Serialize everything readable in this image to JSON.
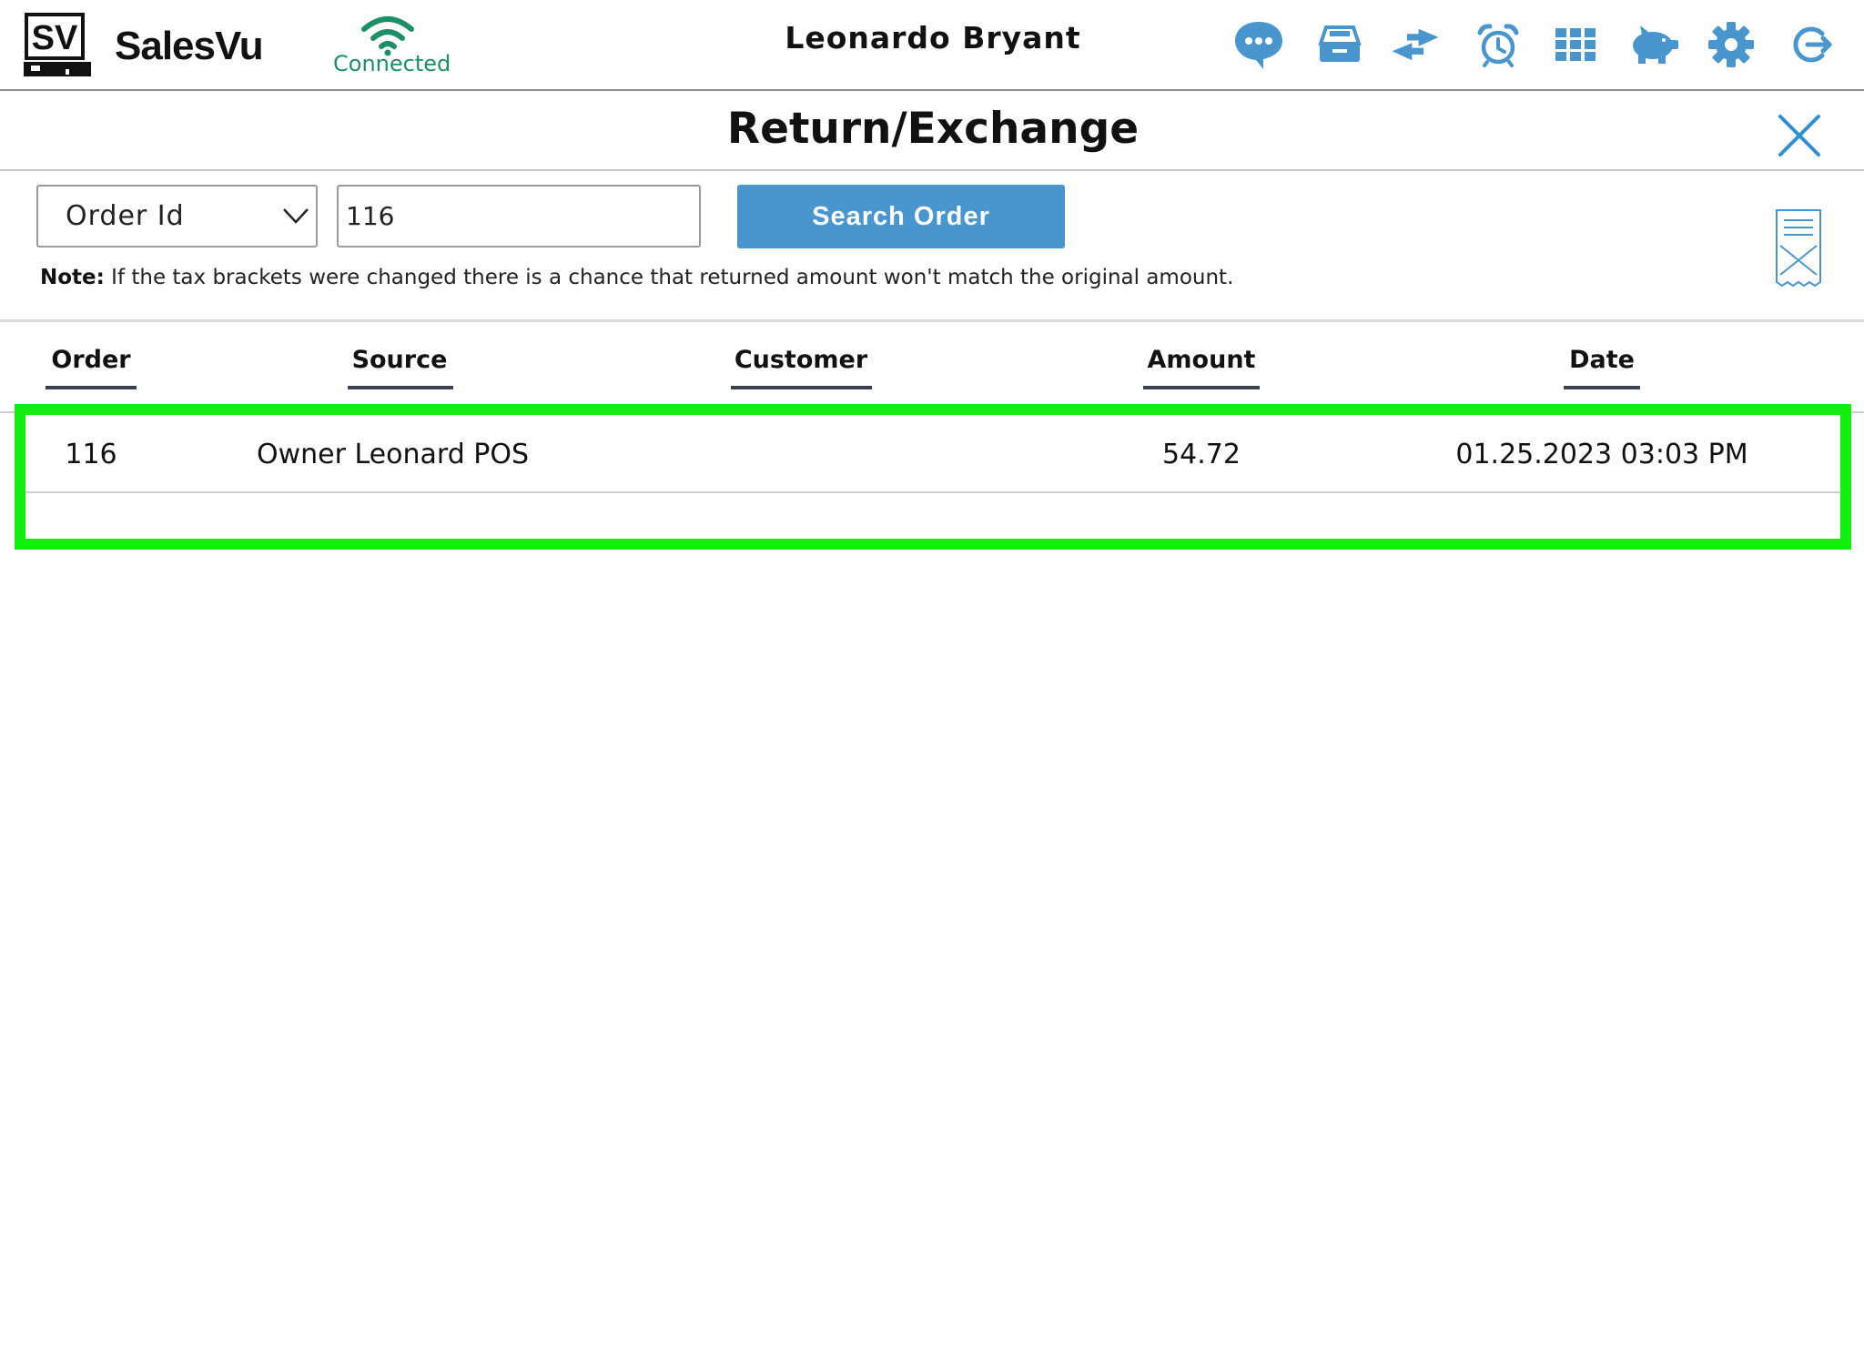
{
  "header": {
    "brand": "SalesVu",
    "logo_text": "SV",
    "status": "Connected",
    "user_name": "Leonardo Bryant",
    "toolbar_icons": [
      "chat-bubble-icon",
      "cash-drawer-icon",
      "exchange-arrows-icon",
      "alarm-clock-icon",
      "grid-apps-icon",
      "piggy-bank-icon",
      "gear-icon",
      "logout-icon"
    ]
  },
  "page": {
    "title": "Return/Exchange"
  },
  "search": {
    "type_selected": "Order Id",
    "value": "116",
    "button_label": "Search Order"
  },
  "note": {
    "label": "Note:",
    "text": " If the tax brackets were changed there is a chance that returned amount won't match the original amount."
  },
  "table": {
    "columns": [
      "Order",
      "Source",
      "Customer",
      "Amount",
      "Date"
    ],
    "rows": [
      {
        "order": "116",
        "source": "Owner Leonard POS",
        "customer": "",
        "amount": "54.72",
        "date": "01.25.2023 03:03 PM"
      }
    ]
  },
  "colors": {
    "accent": "#4896cd",
    "connected": "#1d8f66",
    "highlight": "#12ee12",
    "header_underline": "#394152"
  }
}
